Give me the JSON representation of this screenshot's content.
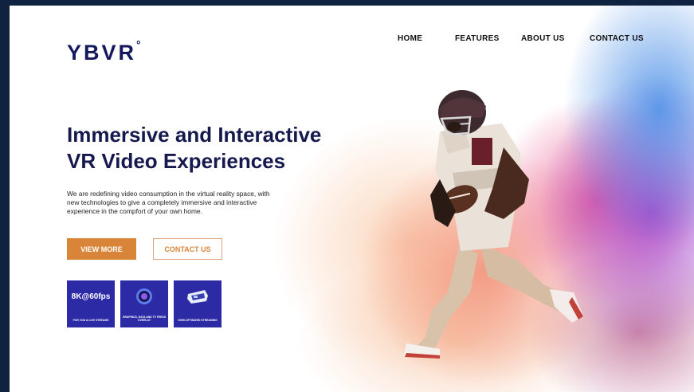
{
  "brand": {
    "logo_text": "YBVR",
    "logo_mark": "°"
  },
  "nav": {
    "items": [
      {
        "label": "HOME"
      },
      {
        "label": "FEATURES"
      },
      {
        "label": "ABOUT US"
      },
      {
        "label": "CONTACT US"
      }
    ]
  },
  "hero": {
    "title_line1": "Immersive and Interactive",
    "title_line2": "VR Video Experiences",
    "subtitle": "We are redefining video consumption in the virtual reality space, with new technologies to give a completely immersive and interactive experience in the compfort of your own home.",
    "primary_button": "VIEW MORE",
    "secondary_button": "CONTACT US"
  },
  "features": [
    {
      "headline": "8K@60fps",
      "caption": "FOR VOD & LIVE STREAMS"
    },
    {
      "icon": "ring-icon",
      "caption": "GRAPHICS, DATA AND TV FEEDS OVERLAY"
    },
    {
      "icon": "vr-headset-icon",
      "caption": "VIEW-OPTIMIZED STREAMING"
    }
  ],
  "colors": {
    "brand_navy": "#15185c",
    "accent_orange": "#d98539",
    "card_blue": "#2d2aa6",
    "outer_background": "#0f2240"
  },
  "hero_image": {
    "subject": "football player running through color powder explosion"
  }
}
